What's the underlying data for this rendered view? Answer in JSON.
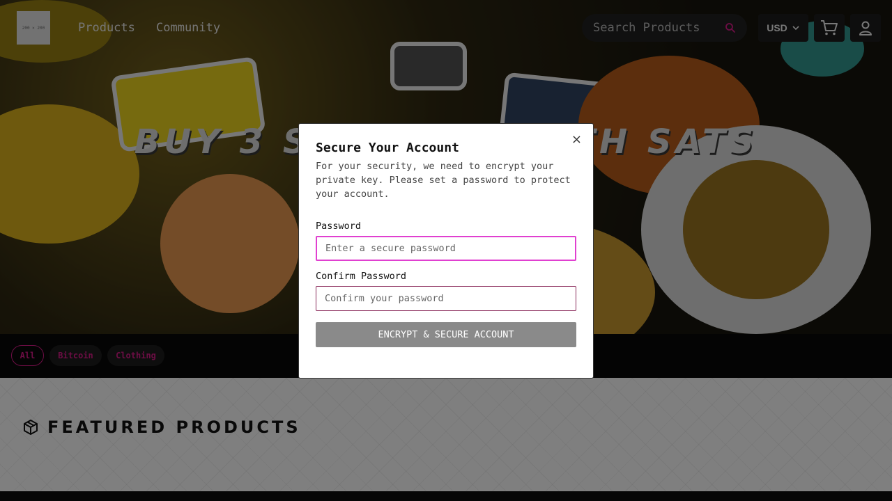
{
  "header": {
    "logo_text": "200 × 200",
    "nav": [
      {
        "label": "Products"
      },
      {
        "label": "Community"
      }
    ],
    "search": {
      "placeholder": "Search Products"
    },
    "currency": {
      "label": "USD"
    }
  },
  "hero": {
    "title": "BUY 3 STICKERS WITH SATS"
  },
  "categories": [
    {
      "label": "All",
      "active": true
    },
    {
      "label": "Bitcoin",
      "active": false
    },
    {
      "label": "Clothing",
      "active": false
    }
  ],
  "featured": {
    "title": "FEATURED PRODUCTS"
  },
  "modal": {
    "title": "Secure Your Account",
    "description": "For your security, we need to encrypt your private key. Please set a password to protect your account.",
    "close_label": "×",
    "password": {
      "label": "Password",
      "placeholder": "Enter a secure password"
    },
    "confirm": {
      "label": "Confirm Password",
      "placeholder": "Confirm your password"
    },
    "submit_label": "ENCRYPT & SECURE ACCOUNT"
  },
  "colors": {
    "accent": "#c5197d",
    "focus": "#e040d0",
    "button": "#8a8a8a"
  }
}
